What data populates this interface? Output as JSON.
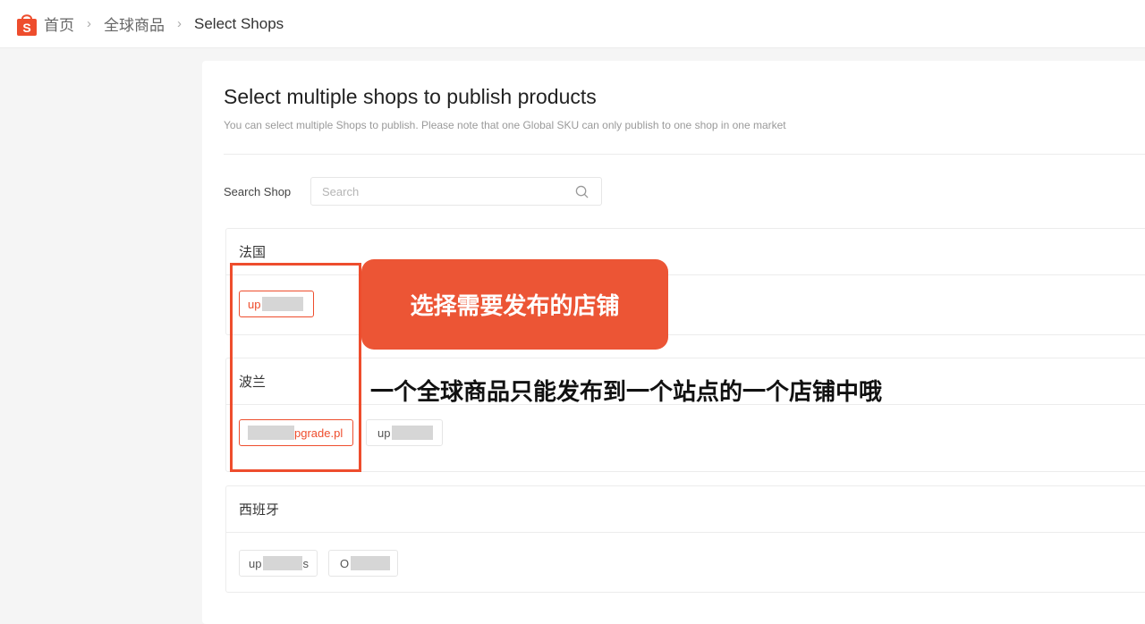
{
  "breadcrumb": {
    "home": "首页",
    "global_products": "全球商品",
    "current": "Select Shops"
  },
  "page": {
    "title": "Select multiple shops to publish products",
    "subtitle": "You can select multiple Shops to publish. Please note that one Global SKU can only publish to one shop in one market"
  },
  "search": {
    "label": "Search Shop",
    "placeholder": "Search"
  },
  "markets": [
    {
      "name": "法国",
      "shops": [
        {
          "label": "up",
          "selected": true
        }
      ]
    },
    {
      "name": "波兰",
      "shops": [
        {
          "label": "pgrade.pl",
          "selected": true
        },
        {
          "label": "up",
          "selected": false
        }
      ]
    },
    {
      "name": "西班牙",
      "shops": [
        {
          "label": "up",
          "suffix": "s",
          "selected": false
        },
        {
          "label": "O",
          "selected": false
        }
      ]
    }
  ],
  "annotations": {
    "callout": "选择需要发布的店铺",
    "note": "一个全球商品只能发布到一个站点的一个店铺中哦"
  },
  "colors": {
    "brand": "#ee4d2d",
    "callout_bg": "#ec5535"
  },
  "icons": {
    "logo": "shopee-bag-icon",
    "search": "search-icon",
    "separator": "chevron-right-icon"
  }
}
